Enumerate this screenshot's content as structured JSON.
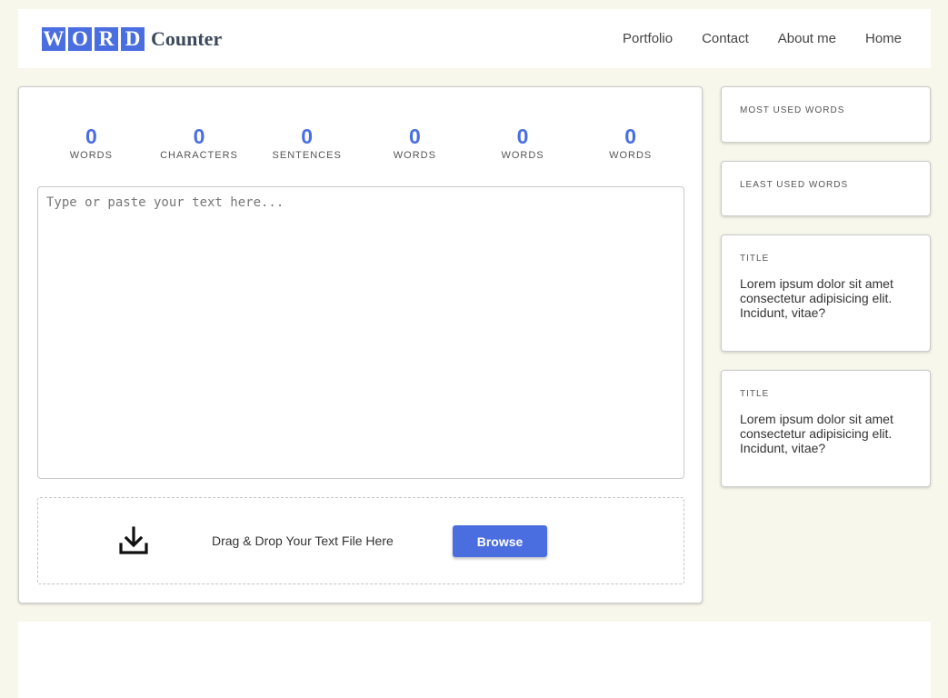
{
  "header": {
    "logo_letters": [
      "W",
      "O",
      "R",
      "D"
    ],
    "logo_rest": "Counter",
    "nav": [
      "Portfolio",
      "Contact",
      "About me",
      "Home"
    ]
  },
  "stats": [
    {
      "value": "0",
      "label": "WORDS"
    },
    {
      "value": "0",
      "label": "CHARACTERS"
    },
    {
      "value": "0",
      "label": "SENTENCES"
    },
    {
      "value": "0",
      "label": "WORDS"
    },
    {
      "value": "0",
      "label": "WORDS"
    },
    {
      "value": "0",
      "label": "WORDS"
    }
  ],
  "editor": {
    "placeholder": "Type or paste your text here...",
    "value": ""
  },
  "dropzone": {
    "icon": "download-icon",
    "text": "Drag & Drop Your Text File Here",
    "button_label": "Browse"
  },
  "sidebar": {
    "most_used_title": "MOST USED WORDS",
    "least_used_title": "LEAST USED WORDS",
    "cards": [
      {
        "title": "TITLE",
        "body": "Lorem ipsum dolor sit amet consectetur adipisicing elit. Incidunt, vitae?"
      },
      {
        "title": "TITLE",
        "body": "Lorem ipsum dolor sit amet consectetur adipisicing elit. Incidunt, vitae?"
      }
    ]
  },
  "colors": {
    "accent": "#4a6ee0",
    "background": "#f7f7ec"
  }
}
